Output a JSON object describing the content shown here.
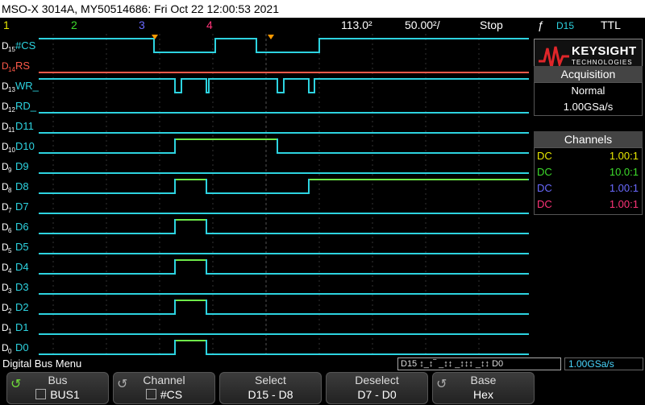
{
  "title_bar": {
    "text": "MSO-X 3014A, MY50514686: Fri Oct 22 12:00:53 2021"
  },
  "status": {
    "ch1": "1",
    "ch2": "2",
    "ch3": "3",
    "ch4": "4",
    "timebase": "113.0²",
    "delay": "50.00²/",
    "run_state": "Stop",
    "trigger_icon": "ƒ",
    "trigger_src": "D15",
    "trigger_level": "TTL"
  },
  "colors": {
    "ch1": "#e8e800",
    "ch2": "#3ddc2b",
    "ch3": "#6a6aff",
    "ch4": "#ff3378",
    "digital": "#2dd3e0",
    "digital_hi": "#6fea4a",
    "dhl": "#ff5a4a"
  },
  "channels": [
    {
      "ch": "D15",
      "label": "#CS"
    },
    {
      "ch": "D14",
      "label": "RS"
    },
    {
      "ch": "D13",
      "label": "WR_"
    },
    {
      "ch": "D12",
      "label": "RD_"
    },
    {
      "ch": "D11",
      "label": "D11"
    },
    {
      "ch": "D10",
      "label": "D10"
    },
    {
      "ch": "D9",
      "label": "D9"
    },
    {
      "ch": "D8",
      "label": "D8"
    },
    {
      "ch": "D7",
      "label": "D7"
    },
    {
      "ch": "D6",
      "label": "D6"
    },
    {
      "ch": "D5",
      "label": "D5"
    },
    {
      "ch": "D4",
      "label": "D4"
    },
    {
      "ch": "D3",
      "label": "D3"
    },
    {
      "ch": "D2",
      "label": "D2"
    },
    {
      "ch": "D1",
      "label": "D1"
    },
    {
      "ch": "D0",
      "label": "D0"
    }
  ],
  "logo": {
    "name": "KEYSIGHT",
    "sub": "TECHNOLOGIES"
  },
  "acquisition": {
    "header": "Acquisition",
    "mode": "Normal",
    "rate": "1.00GSa/s"
  },
  "channels_panel": {
    "header": "Channels",
    "rows": [
      {
        "coupling": "DC",
        "ratio": "1.00:1",
        "color": "#e8e800"
      },
      {
        "coupling": "DC",
        "ratio": "10.0:1",
        "color": "#3ddc2b"
      },
      {
        "coupling": "DC",
        "ratio": "1.00:1",
        "color": "#6a6aff"
      },
      {
        "coupling": "DC",
        "ratio": "1.00:1",
        "color": "#ff3378"
      }
    ]
  },
  "menu": {
    "title": "Digital Bus Menu",
    "bus_strip": "D15 ↕_↕‾ _↕↕ _↕↕↕ _↕↕ D0",
    "sample_rate": "1.00GSa/s"
  },
  "softkeys": [
    {
      "label": "Bus",
      "value": "BUS1",
      "has_check": true
    },
    {
      "label": "Channel",
      "value": "#CS",
      "has_check": true
    },
    {
      "label": "Select",
      "value": "D15 - D8",
      "has_check": false
    },
    {
      "label": "Deselect",
      "value": "D7 - D0",
      "has_check": false
    },
    {
      "label": "Base",
      "value": "Hex",
      "has_check": false
    }
  ]
}
